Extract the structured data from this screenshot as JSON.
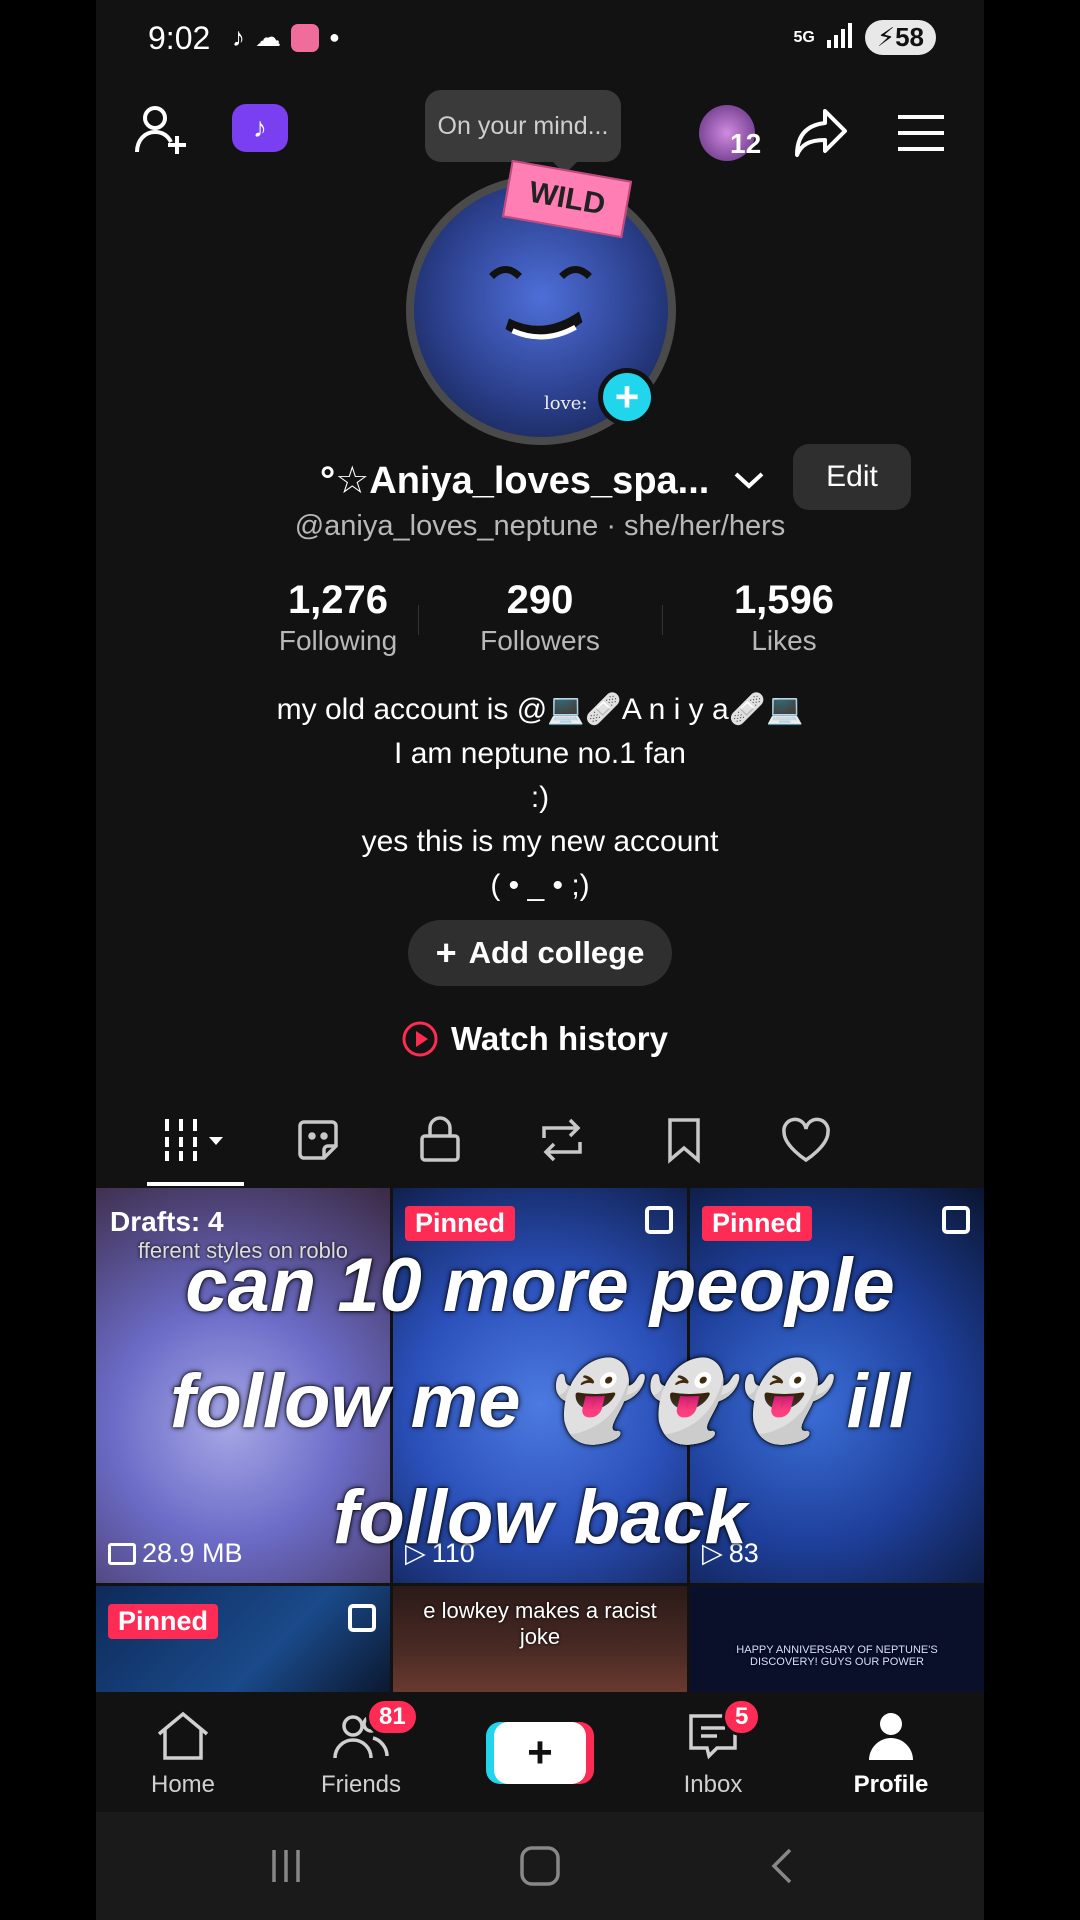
{
  "status_bar": {
    "time": "9:02",
    "network": "5G",
    "battery": "58"
  },
  "top_bar": {
    "mind_prompt": "On your mind...",
    "notifications_count": "12"
  },
  "profile": {
    "avatar_sticker": "WILD",
    "avatar_caption": "love:",
    "display_name": "°☆Aniya_loves_spa...",
    "edit_label": "Edit",
    "handle_line": "@aniya_loves_neptune · she/her/hers",
    "stats": [
      {
        "value": "1,276",
        "label": "Following"
      },
      {
        "value": "290",
        "label": "Followers"
      },
      {
        "value": "1,596",
        "label": "Likes"
      }
    ],
    "bio": [
      "my old account is @💻🩹A n i y a🩹💻",
      "I am neptune no.1 fan",
      ":)",
      "yes this is my new account",
      "( • _ • ;)"
    ],
    "add_college": "Add college",
    "watch_history": "Watch history"
  },
  "tabs": [
    "videos",
    "sticker",
    "private",
    "reposts",
    "favorites",
    "liked"
  ],
  "grid": {
    "overlay_text": [
      "can 10 more people",
      "follow me 👻👻👻 ill",
      "follow back"
    ],
    "cells": [
      {
        "badge": "Drafts: 4",
        "caption": "fferent styles on roblo",
        "meta": "28.9 MB"
      },
      {
        "badge": "Pinned",
        "meta": "110"
      },
      {
        "badge": "Pinned",
        "meta": "83"
      },
      {
        "badge": "Pinned"
      },
      {
        "caption": "e lowkey makes a racist joke"
      },
      {
        "caption": "HAPPY ANNIVERSARY OF NEPTUNE'S DISCOVERY! GUYS OUR POWER"
      }
    ]
  },
  "bottom_nav": {
    "items": [
      {
        "label": "Home"
      },
      {
        "label": "Friends",
        "badge": "81"
      },
      {
        "label": "Inbox",
        "badge": "5"
      },
      {
        "label": "Profile"
      }
    ]
  },
  "colors": {
    "accent_red": "#fe2c55",
    "accent_cyan": "#20d5ec"
  }
}
